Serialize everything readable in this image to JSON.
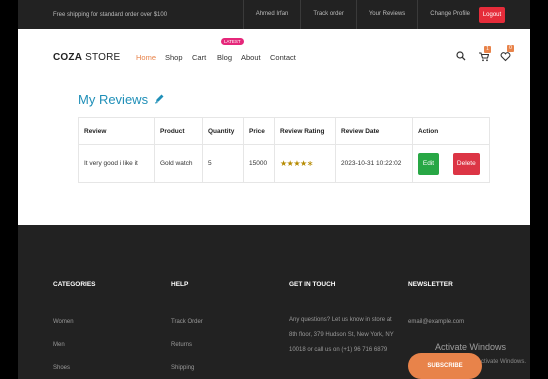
{
  "topbar": {
    "shipping_text": "Free shipping for standard order over $100",
    "links": [
      "Ahmed Irfan",
      "Track order",
      "Your Reviews",
      "Change Profile"
    ],
    "logout_label": "Logout"
  },
  "header": {
    "logo_bold": "COZA",
    "logo_rest": " STORE",
    "nav": [
      "Home",
      "Shop",
      "Cart",
      "Blog",
      "About",
      "Contact"
    ],
    "active_nav": "Home",
    "latest_badge": "LATEST",
    "cart_count": "1",
    "wishlist_count": "0"
  },
  "reviews": {
    "title": "My Reviews",
    "columns": [
      "Review",
      "Product",
      "Quantity",
      "Price",
      "Review Rating",
      "Review Date",
      "Action"
    ],
    "rows": [
      {
        "review": "It very good i like it",
        "product": "Gold watch",
        "quantity": "5",
        "price": "15000",
        "rating": 4,
        "rating_max": 5,
        "date": "2023-10-31 10:22:02",
        "edit_label": "Edit",
        "delete_label": "Delete"
      }
    ]
  },
  "footer": {
    "categories": {
      "heading": "CATEGORIES",
      "items": [
        "Women",
        "Men",
        "Shoes"
      ]
    },
    "help": {
      "heading": "HELP",
      "items": [
        "Track Order",
        "Returns",
        "Shipping"
      ]
    },
    "get_in_touch": {
      "heading": "GET IN TOUCH",
      "text": "Any questions? Let us know in store at 8th floor, 379 Hudson St, New York, NY 10018 or call us on (+1) 96 716 6879"
    },
    "newsletter": {
      "heading": "NEWSLETTER",
      "email_placeholder": "email@example.com",
      "subscribe_label": "SUBSCRIBE"
    }
  },
  "watermark": {
    "line1": "Activate Windows",
    "line2": "ctivate Windows."
  },
  "colors": {
    "accent": "#e8834a",
    "title_blue": "#1f8fb8",
    "logout_red": "#e52c3a",
    "edit_green": "#28a745",
    "delete_red": "#dc3545",
    "footer_bg": "#222222"
  }
}
